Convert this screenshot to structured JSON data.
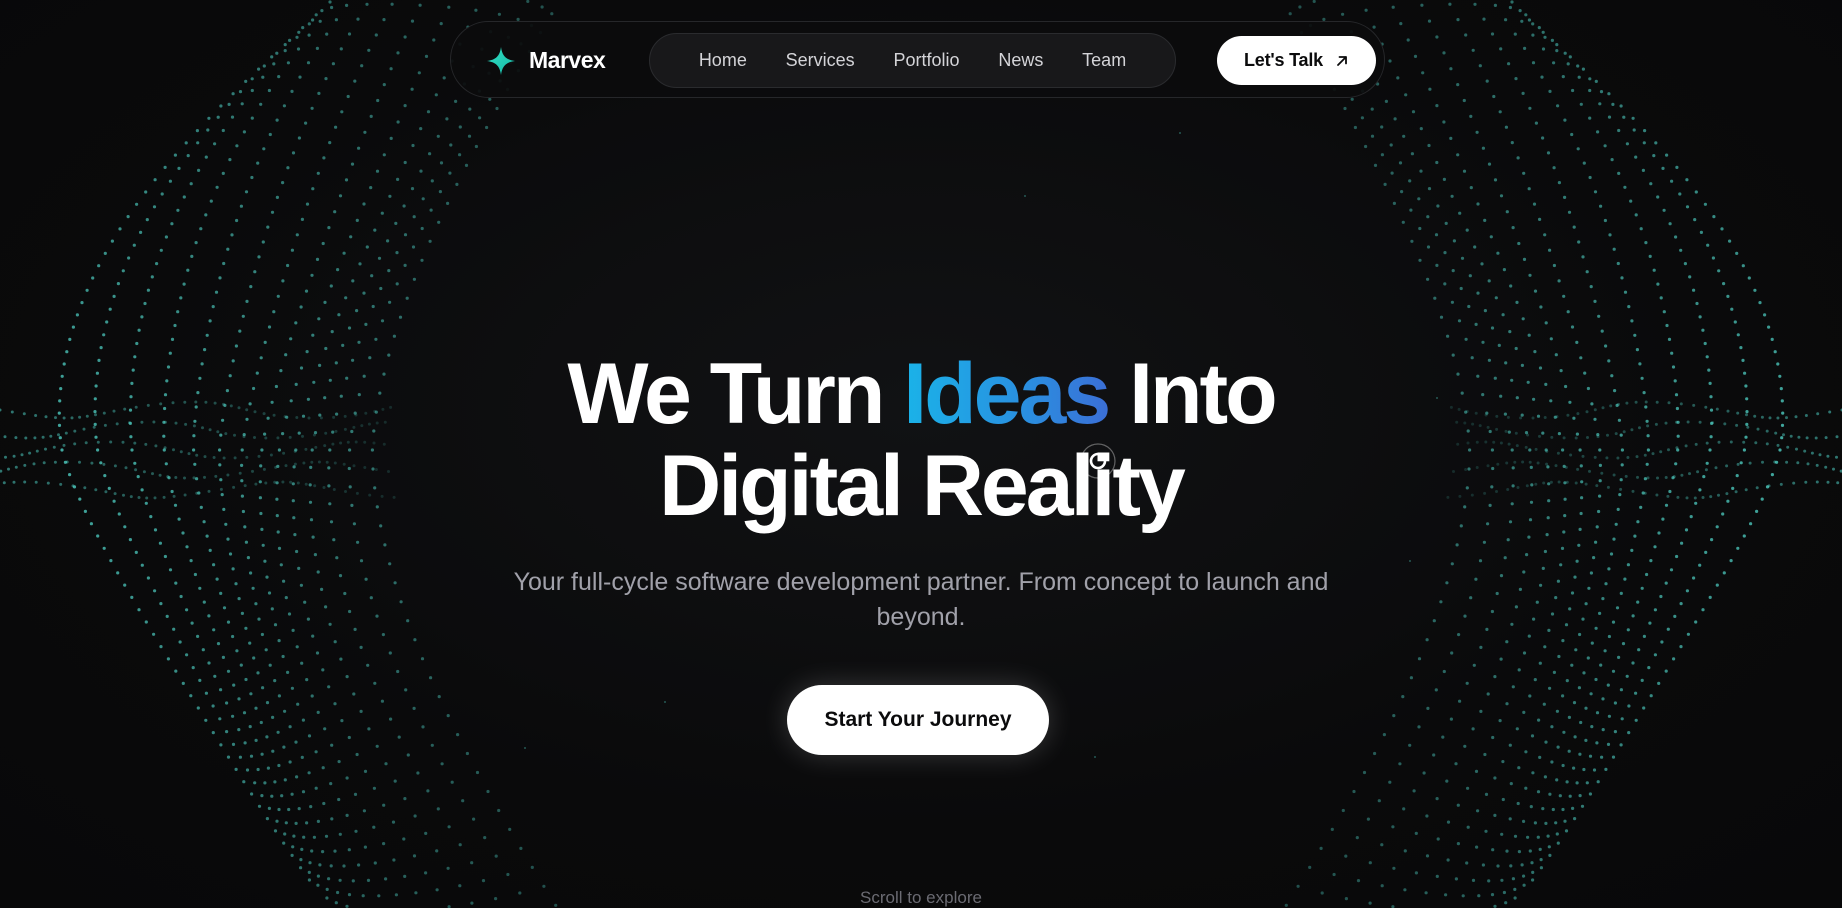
{
  "nav": {
    "brand": "Marvex",
    "brand_icon": "four-point-star-icon",
    "menu": [
      "Home",
      "Services",
      "Portfolio",
      "News",
      "Team"
    ],
    "cta_label": "Let's Talk",
    "cta_icon": "arrow-up-right-icon"
  },
  "hero": {
    "title_part1": "We Turn ",
    "title_accent": "Ideas",
    "title_part2": " Into",
    "title_line2": "Digital Reality",
    "subtitle": "Your full-cycle software development partner. From concept to launch and beyond.",
    "cta_label": "Start Your Journey"
  },
  "scroll_hint": "Scroll to explore",
  "colors": {
    "background": "#0a0a0b",
    "accent_start": "#1ab3e8",
    "accent_end": "#3b6fd6",
    "particles": "#4fd1c5",
    "brand_icon": "#2dd4bf"
  },
  "decor": {
    "background_pattern": "dotted-wave-particles",
    "cursor": "ring-cursor-icon"
  }
}
